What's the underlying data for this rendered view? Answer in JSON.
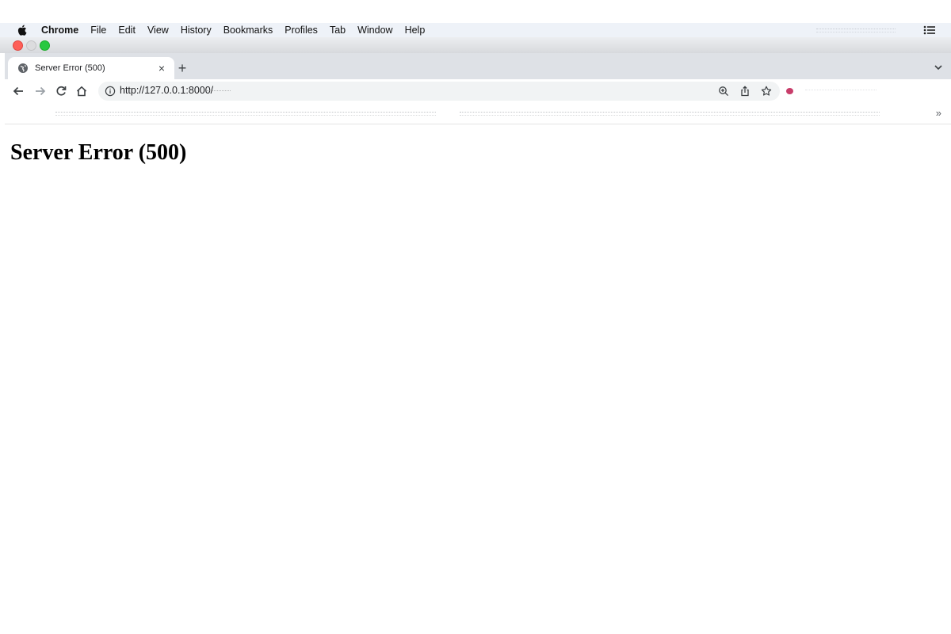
{
  "menubar": {
    "app_name": "Chrome",
    "items": [
      "File",
      "Edit",
      "View",
      "History",
      "Bookmarks",
      "Profiles",
      "Tab",
      "Window",
      "Help"
    ]
  },
  "tab": {
    "title": "Server Error (500)",
    "close_glyph": "×",
    "new_tab_glyph": "+"
  },
  "omnibox": {
    "url": "http://127.0.0.1:8000/"
  },
  "bookmarks": {
    "more_glyph": "»"
  },
  "page": {
    "heading": "Server Error (500)"
  },
  "colors": {
    "close_light": "#fe5f57",
    "zoom_light": "#28c840",
    "extension_dot": "#c83d6a",
    "tabstrip_bg": "#dee1e6"
  },
  "icons": {
    "apple": "apple-icon",
    "favicon": "globe-icon",
    "back": "arrow-left-icon",
    "forward": "arrow-right-icon",
    "reload": "reload-icon",
    "home": "home-icon",
    "info": "info-icon",
    "zoom": "zoom-icon",
    "share": "share-icon",
    "bookmark_star": "star-icon",
    "control_center": "control-center-icon",
    "tab_search": "chevron-down-icon"
  }
}
